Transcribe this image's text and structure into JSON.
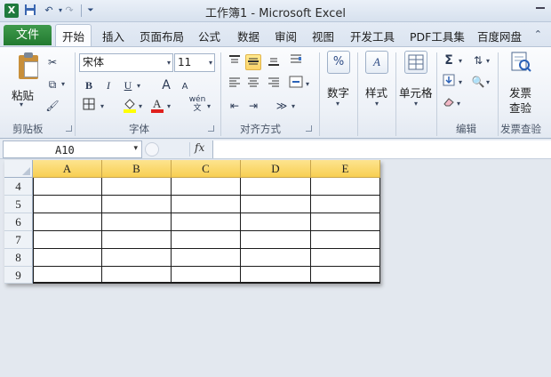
{
  "window": {
    "title": "工作簿1 - Microsoft Excel",
    "app_icon_label": "X",
    "quick_access": [
      "save-icon",
      "undo-icon",
      "redo-icon",
      "customize-icon"
    ]
  },
  "tabs": {
    "file": "文件",
    "items": [
      "开始",
      "插入",
      "页面布局",
      "公式",
      "数据",
      "审阅",
      "视图",
      "开发工具",
      "PDF工具集",
      "百度网盘"
    ],
    "active": "开始"
  },
  "ribbon": {
    "clipboard": {
      "paste_label": "粘贴",
      "group_label": "剪贴板"
    },
    "font": {
      "name": "宋体",
      "size": "11",
      "group_label": "字体",
      "bold": "B",
      "italic": "I",
      "underline": "U",
      "grow": "A",
      "shrink": "A",
      "phonetic": "wén"
    },
    "alignment": {
      "group_label": "对齐方式"
    },
    "number": {
      "button_label": "数字",
      "icon": "%"
    },
    "styles": {
      "button_label": "样式",
      "icon": "A"
    },
    "cells": {
      "button_label": "单元格"
    },
    "editing": {
      "group_label": "编辑",
      "sigma": "Σ"
    },
    "invoice": {
      "button_line1": "发票",
      "button_line2": "查验",
      "group_label": "发票查验"
    }
  },
  "formula_bar": {
    "name_box": "A10",
    "fx_label": "fx",
    "formula": ""
  },
  "sheet": {
    "columns": [
      "A",
      "B",
      "C",
      "D",
      "E"
    ],
    "rows": [
      "4",
      "5",
      "6",
      "7",
      "8",
      "9"
    ],
    "header_color": "#f9d35b",
    "cells": [
      [
        "",
        "",
        "",
        "",
        ""
      ],
      [
        "",
        "",
        "",
        "",
        ""
      ],
      [
        "",
        "",
        "",
        "",
        ""
      ],
      [
        "",
        "",
        "",
        "",
        ""
      ],
      [
        "",
        "",
        "",
        "",
        ""
      ],
      [
        "",
        "",
        "",
        "",
        ""
      ]
    ]
  }
}
